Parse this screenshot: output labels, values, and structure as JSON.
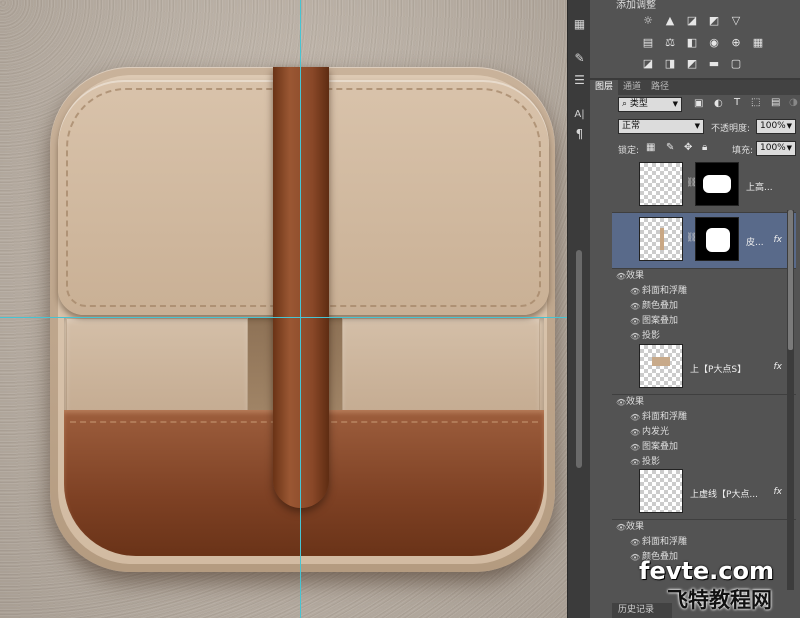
{
  "toolstrip": {
    "tools": [
      {
        "icon": "notes-icon",
        "glyph": "▦"
      },
      {
        "icon": "brush-settings-icon",
        "glyph": "✎"
      },
      {
        "icon": "adjust-sliders-icon",
        "glyph": "☰"
      },
      {
        "icon": "character-icon",
        "glyph": "A|"
      },
      {
        "icon": "paragraph-icon",
        "glyph": "¶"
      }
    ]
  },
  "adjustments": {
    "header": "添加调整",
    "row1": [
      {
        "icon": "brightness-icon",
        "glyph": "☼"
      },
      {
        "icon": "levels-icon",
        "glyph": "▲"
      },
      {
        "icon": "curves-icon",
        "glyph": "◪"
      },
      {
        "icon": "exposure-icon",
        "glyph": "◩"
      },
      {
        "icon": "vibrance-icon",
        "glyph": "▽"
      }
    ],
    "row2": [
      {
        "icon": "hue-saturation-icon",
        "glyph": "▤"
      },
      {
        "icon": "color-balance-icon",
        "glyph": "⚖"
      },
      {
        "icon": "black-white-icon",
        "glyph": "◧"
      },
      {
        "icon": "photo-filter-icon",
        "glyph": "◉"
      },
      {
        "icon": "channel-mixer-icon",
        "glyph": "⊕"
      },
      {
        "icon": "color-lookup-icon",
        "glyph": "▦"
      }
    ],
    "row3": [
      {
        "icon": "invert-icon",
        "glyph": "◪"
      },
      {
        "icon": "posterize-icon",
        "glyph": "◨"
      },
      {
        "icon": "threshold-icon",
        "glyph": "◩"
      },
      {
        "icon": "gradient-map-icon",
        "glyph": "▬"
      },
      {
        "icon": "selective-color-icon",
        "glyph": "▢"
      }
    ]
  },
  "layers_panel": {
    "tabs": [
      "图层",
      "通道",
      "路径"
    ],
    "active_tab": "图层",
    "filter_type": "类型",
    "blend_mode": "正常",
    "opacity_label": "不透明度:",
    "opacity_value": "100%",
    "lock_label": "锁定:",
    "fill_label": "填充:",
    "fill_value": "100%",
    "layers": [
      {
        "name": "上高...",
        "selected": false,
        "has_mask": true,
        "fx": false,
        "effects": []
      },
      {
        "name": "皮...",
        "selected": true,
        "has_mask": true,
        "fx": true,
        "effects_header": "效果",
        "effects": [
          "斜面和浮雕",
          "颜色叠加",
          "图案叠加",
          "投影"
        ]
      },
      {
        "name": "上【P大点S】",
        "selected": false,
        "has_mask": false,
        "fx": true,
        "effects_header": "效果",
        "effects": [
          "斜面和浮雕",
          "内发光",
          "图案叠加",
          "投影"
        ]
      },
      {
        "name": "上虚线【P大点...",
        "selected": false,
        "has_mask": false,
        "fx": true,
        "effects_header": "效果",
        "effects": [
          "斜面和浮雕",
          "颜色叠加"
        ]
      }
    ],
    "history_tab": "历史记录"
  },
  "watermark": {
    "line1": "fevte.com",
    "line2": "飞特教程网"
  },
  "colors": {
    "guide": "#47c4d3",
    "selected_layer": "#596a8a",
    "panel_bg": "#535353"
  }
}
